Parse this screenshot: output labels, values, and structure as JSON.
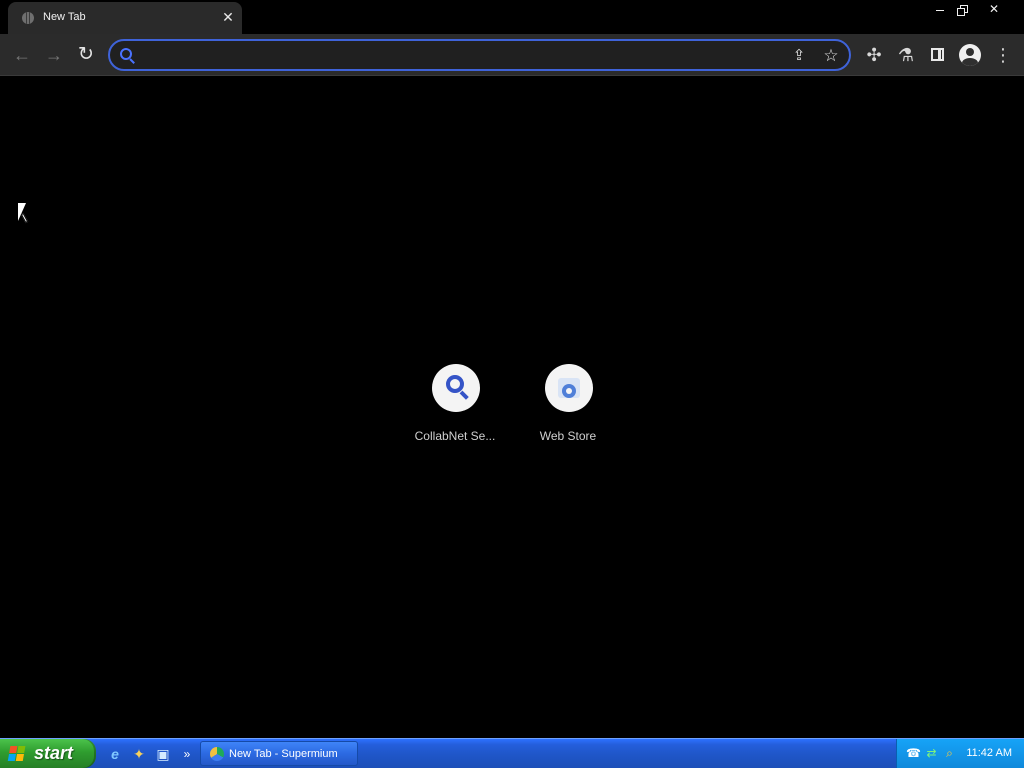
{
  "browser": {
    "tab": {
      "title": "New Tab",
      "close": "✕",
      "icon": "globe-icon"
    },
    "window_controls": {
      "minimize": "minimize-icon",
      "restore": "restore-icon",
      "close": "✕"
    },
    "toolbar": {
      "back": "←",
      "forward": "→",
      "reload": "↻",
      "omnibox_value": "",
      "omnibox_placeholder": "",
      "share": "⇪",
      "bookmark": "☆",
      "extensions": "✣",
      "labs": "⚗",
      "side_panel": "side-panel-icon",
      "profile": "profile-icon",
      "menu": "⋮"
    }
  },
  "new_tab": {
    "shortcuts": [
      {
        "label": "CollabNet Se...",
        "icon": "search-icon"
      },
      {
        "label": "Web Store",
        "icon": "web-store-icon"
      }
    ]
  },
  "taskbar": {
    "start_label": "start",
    "quick_launch": [
      "internet-explorer-icon",
      "media-player-icon",
      "desktop-icon",
      "»"
    ],
    "active_task": "New Tab - Supermium",
    "clock": "11:42 AM",
    "tray_icons": [
      "phone-icon",
      "network-icon",
      "search-icon"
    ]
  },
  "colors": {
    "background": "#000000",
    "toolbar": "#2b2b2b",
    "omnibox_focus": "#3f63d9",
    "taskbar_blue": "#245edb",
    "start_green": "#2f9d2f"
  }
}
